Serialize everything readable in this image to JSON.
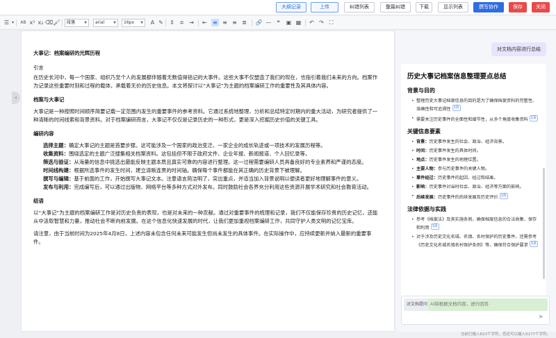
{
  "topbar": {
    "buttons": [
      {
        "label": "大纲记录",
        "style": "outline-blue"
      },
      {
        "label": "上传",
        "style": "outline-blue"
      },
      {
        "label": "纠错列表",
        "style": "plain"
      },
      {
        "label": "整篇纠错",
        "style": "plain"
      },
      {
        "label": "下载",
        "style": "plain"
      },
      {
        "label": "显示列表",
        "style": "plain"
      },
      {
        "label": "撰写协作",
        "style": "blue"
      },
      {
        "label": "保存",
        "style": "red"
      },
      {
        "label": "关闭",
        "style": "red"
      }
    ]
  },
  "toolbar": {
    "paragraph_style": "段落",
    "font_family": "arial",
    "font_size": "16px"
  },
  "document": {
    "title": "大事记：档案编研的光辉历程",
    "intro_heading": "引言",
    "intro_text": "在历史长河中，每一个国家、组织乃至个人的发展都伴随着无数值得铭记的大事件。这些大事不仅塑造了我们的现在，也指引着我们未来的方向。档案作为记录这些重要时刻和过程的载体，承载着无价的历史信息。本文将探讨以“大事记”为主题的档案编研工作的重要性及其具体内容。",
    "section1_heading": "档案与大事记",
    "section1_text": "大事记是一种按照时间顺序简要记载一定范围内发生的重要事件的参考资料。它通过系统地整理、分析和总结特定时期内的重大活动，为研究者提供了一种清晰的时间线索和背景资料。对于档案编研而言，大事记不仅仅是记录历史的一种形式，更是深入挖掘历史价值的关键工具。",
    "section2_heading": "编研内容",
    "section2_items": [
      {
        "term": "选择主题：",
        "text": "确定大事记的主题是首要步骤。这可能涉及一个国家的政治变迁、一家企业的成长轨迹或一项技术的发展历程等。"
      },
      {
        "term": "收集资料：",
        "text": "围绕选定的主题广泛搜集相关档案资料。这包括但不限于政府文件、企业年报、新闻报道、个人回忆录等。"
      },
      {
        "term": "筛选与验证：",
        "text": "从海量的信息中挑选出最能反映主题本质且真实可靠的内容进行整理。这一过程需要编研人员具备良好的专业素养和严谨的态度。"
      },
      {
        "term": "时间线构建：",
        "text": "根据所选事件的发生时间，建立清晰连贯的时间轴。确保每个事件都能在其正确的历史背景下被理解。"
      },
      {
        "term": "撰写与编辑：",
        "text": "基于前面的工作，开始撰写大事记文本。注意语言简洁明了，突出重点，并适当加入背景说明以便读者更好地理解事件的意义。"
      },
      {
        "term": "发布与利用：",
        "text": "完成编写后，可以通过出版物、网络平台等多种方式对外发布。同时鼓励社会各界充分利用这些资源开展学术研究和社会教育活动。"
      }
    ],
    "conclusion_heading": "结语",
    "conclusion_text": "以“大事记”为主题的档案编研工作是对历史负责的表现，也是对未来的一种贡献。通过对重要事件的梳理和记录，我们不仅能保存珍贵的历史记忆，还能从中汲取智慧和力量，推动社会不断向前发展。在这个信息化快速发展的时代，让我们更加重视档案编研工作，共同守护人类文明的记忆宝库。",
    "note_text": "请注意，由于当前时间为2025年4月8日，上述内容未包含任何未来可能发生但尚未发生的具体事件。在实际操作中，应持续更新并纳入最新的重要事件。"
  },
  "panel": {
    "user_message": "对文档内容进行总结",
    "summary_title": "历史大事记档案信息整理要点总结",
    "sections": [
      {
        "heading": "背景与目的",
        "items": [
          {
            "term": "",
            "text": "整理历史大事记档案信息的目的是为了确保档案资料的完整性、准确性和可追溯性",
            "ref": "1页"
          },
          {
            "term": "",
            "text": "需要关注历史事件的全面性和细节性，从多个角度收集资料",
            "ref": "1页"
          }
        ]
      },
      {
        "heading": "关键信息要素",
        "items": [
          {
            "term": "背景：",
            "text": "历史事件发生的社会、政治、经济背景。",
            "ref": ""
          },
          {
            "term": "时间：",
            "text": "历史事件发生的具体时间。",
            "ref": ""
          },
          {
            "term": "地点：",
            "text": "历史事件发生的地理位置。",
            "ref": ""
          },
          {
            "term": "主要人物：",
            "text": "参与历史事件的关键人物。",
            "ref": ""
          },
          {
            "term": "事件经过：",
            "text": "历史事件的起因、经过和结果。",
            "ref": ""
          },
          {
            "term": "影响：",
            "text": "历史事件对当时社会、政治、经济等方面的影响。",
            "ref": ""
          },
          {
            "term": "后续发展：",
            "text": "历史事件的后续发展及历史评价",
            "ref": "1页"
          }
        ]
      },
      {
        "heading": "法律依据与实践",
        "items": [
          {
            "term": "",
            "text": "参考《档案法》及其实施条例，确保档案信息的合法收集、保存和利用",
            "ref": "1页"
          },
          {
            "term": "",
            "text": "对于涉及历史文化名城、名镇、名村保护的历史事件，还需参考《历史文化名城名镇名村保护条例》等，确保符合保护要求",
            "ref": "1页"
          }
        ]
      }
    ],
    "input_tag": "对文档提问",
    "input_placeholder": "AI将根据文档内容，进行回答"
  },
  "status": {
    "text": "当前已输入823个字符，您还可以输入9177个字符。"
  },
  "colors": {
    "accent_blue": "#2f6de0",
    "danger_red": "#e84a4a",
    "input_highlight": "#d9efd3",
    "user_bubble": "#e8e4fb"
  }
}
